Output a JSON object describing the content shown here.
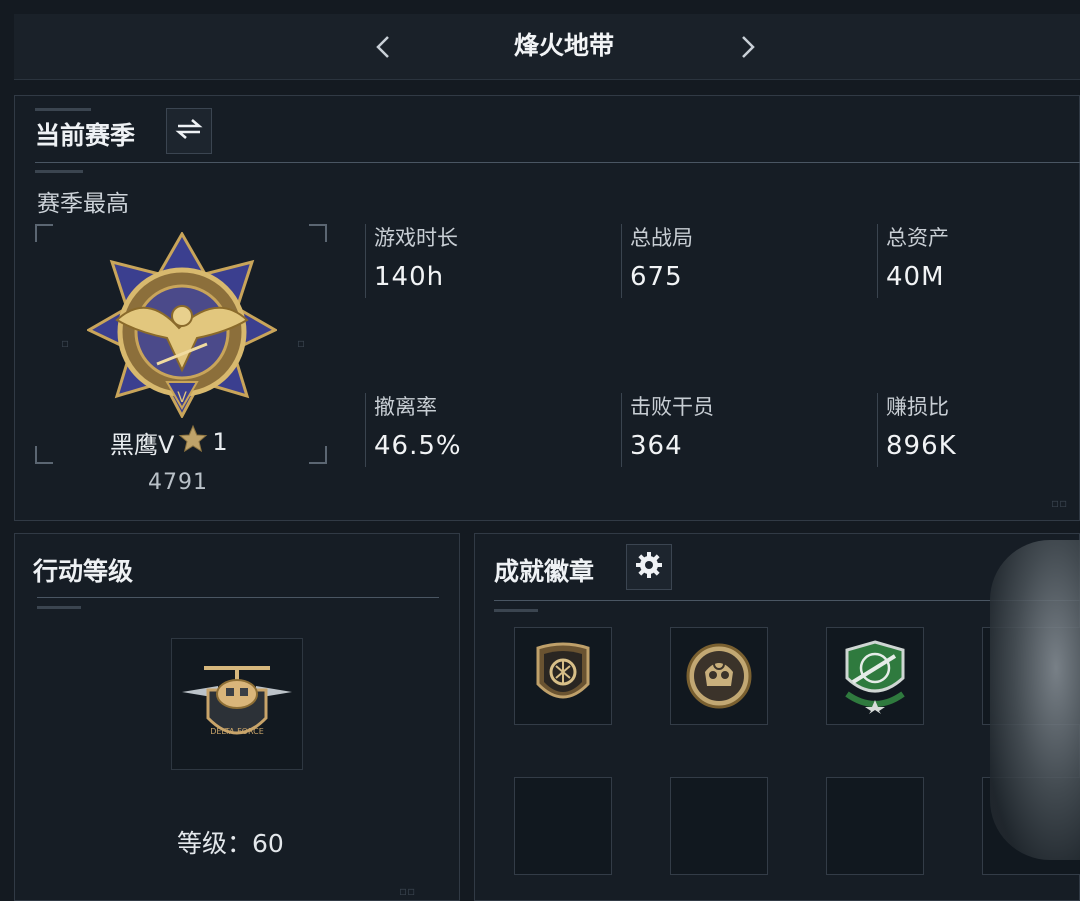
{
  "header": {
    "title": "烽火地带",
    "prev_icon": "chevron-left-icon",
    "next_icon": "chevron-right-icon"
  },
  "season": {
    "title": "当前赛季",
    "switch_icon": "swap-arrows-icon",
    "subtitle": "赛季最高",
    "rank": {
      "name": "黑鹰V",
      "stars": "1",
      "star_icon": "star-icon",
      "score": "4791"
    },
    "stats": [
      {
        "label": "游戏时长",
        "value": "140h"
      },
      {
        "label": "总战局",
        "value": "675"
      },
      {
        "label": "总资产",
        "value": "40M"
      },
      {
        "label": "撤离率",
        "value": "46.5%"
      },
      {
        "label": "击败干员",
        "value": "364"
      },
      {
        "label": "赚损比",
        "value": "896K"
      }
    ]
  },
  "operation_level": {
    "title": "行动等级",
    "level_label": "等级：",
    "level_value": "60",
    "emblem_icon": "helicopter-emblem-icon"
  },
  "achievements": {
    "title": "成就徽章",
    "settings_icon": "gear-icon",
    "badges": [
      {
        "icon": "shield-badge-icon",
        "filled": true
      },
      {
        "icon": "skull-badge-icon",
        "filled": true
      },
      {
        "icon": "rifle-badge-icon",
        "filled": true
      },
      {
        "icon": "empty-slot",
        "filled": false
      },
      {
        "icon": "empty-slot",
        "filled": false
      },
      {
        "icon": "empty-slot",
        "filled": false
      },
      {
        "icon": "empty-slot",
        "filled": false
      },
      {
        "icon": "empty-slot",
        "filled": false
      }
    ]
  },
  "colors": {
    "background": "#141a21",
    "panel": "#161d25",
    "gold": "#c9a55a",
    "medal_blue": "#3b3f8f",
    "badge_green": "#2f7a3e"
  }
}
